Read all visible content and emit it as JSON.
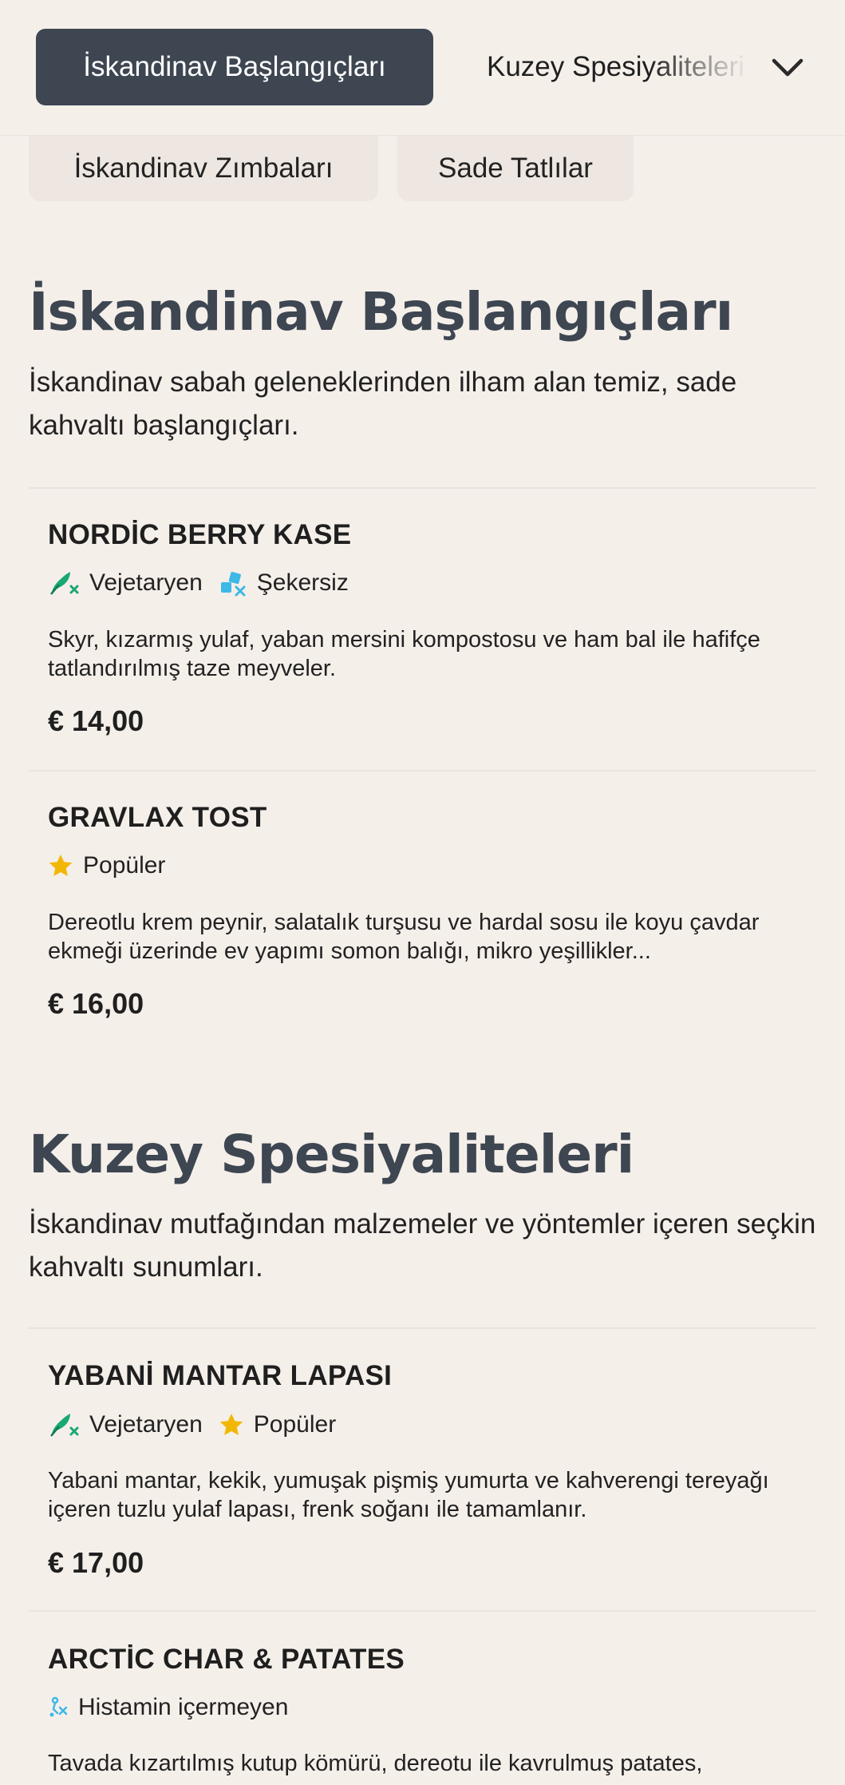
{
  "nav": {
    "active_category": "İskandinav Başlangıçları",
    "next_category": "Kuzey Spesiyaliteleri",
    "subcategories": [
      "İskandinav Zımbaları",
      "Sade Tatlılar"
    ]
  },
  "sections": [
    {
      "title": "İskandinav Başlangıçları",
      "description": "İskandinav sabah geleneklerinden ilham alan temiz, sade kahvaltı başlangıçları.",
      "items": [
        {
          "name": "NORDİC BERRY KASE",
          "tags": [
            {
              "icon": "vegetarian-icon",
              "label": "Vejetaryen"
            },
            {
              "icon": "sugar-free-icon",
              "label": "Şekersiz"
            }
          ],
          "description": "Skyr, kızarmış yulaf, yaban mersini kompostosu ve ham bal ile hafifçe tatlandırılmış taze meyveler.",
          "price": "€ 14,00"
        },
        {
          "name": "GRAVLAX TOST",
          "tags": [
            {
              "icon": "star-icon",
              "label": "Popüler"
            }
          ],
          "description": "Dereotlu krem peynir, salatalık turşusu ve hardal sosu ile koyu çavdar ekmeği üzerinde ev yapımı somon balığı, mikro yeşillikler...",
          "price": "€ 16,00"
        }
      ]
    },
    {
      "title": "Kuzey Spesiyaliteleri",
      "description": "İskandinav mutfağından malzemeler ve yöntemler içeren seçkin kahvaltı sunumları.",
      "items": [
        {
          "name": "YABANİ MANTAR LAPASI",
          "tags": [
            {
              "icon": "vegetarian-icon",
              "label": "Vejetaryen"
            },
            {
              "icon": "star-icon",
              "label": "Popüler"
            }
          ],
          "description": "Yabani mantar, kekik, yumuşak pişmiş yumurta ve kahverengi tereyağı içeren tuzlu yulaf lapası, frenk soğanı ile tamamlanır.",
          "price": "€ 17,00"
        },
        {
          "name": "ARCTİC CHAR & PATATES",
          "tags": [
            {
              "icon": "histamine-free-icon",
              "label": "Histamin içermeyen"
            }
          ],
          "description": "Tavada kızartılmış kutup kömürü, dereotu ile kavrulmuş patates,",
          "price": ""
        }
      ]
    }
  ],
  "colors": {
    "background": "#f5efea",
    "active_tab": "#3d4651",
    "heading": "#3d4651",
    "vegetarian": "#1aa872",
    "sugar_free": "#3cb9e6",
    "star": "#f2b705"
  }
}
